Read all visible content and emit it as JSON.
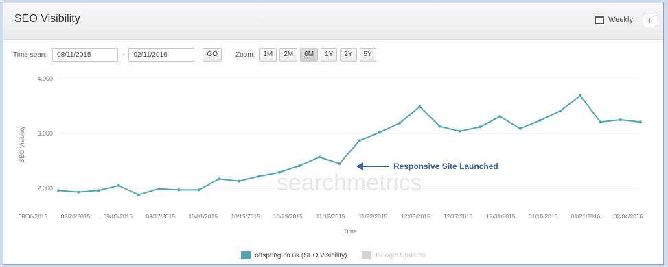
{
  "widget": {
    "title": "SEO Visibility",
    "weekly_label": "Weekly",
    "add_label": "+"
  },
  "controls": {
    "time_span_label": "Time span:",
    "date_from": "08/11/2015",
    "date_sep": "-",
    "date_to": "02/11/2016",
    "go_label": "GO",
    "zoom_label": "Zoom:",
    "zoom_options": [
      "1M",
      "2M",
      "6M",
      "1Y",
      "2Y",
      "5Y"
    ],
    "zoom_active": "6M"
  },
  "chart_data": {
    "type": "line",
    "ylabel": "SEO Visibility",
    "xlabel": "Time",
    "ylim": [
      1800,
      4000
    ],
    "y_ticks": [
      "4,000",
      "3,000",
      "2,000"
    ],
    "x_tick_labels": [
      "08/06/2015",
      "08/20/2015",
      "09/03/2015",
      "09/17/2015",
      "10/01/2015",
      "10/15/2015",
      "10/29/2015",
      "11/12/2015",
      "11/22/2015",
      "12/03/2015",
      "12/17/2015",
      "12/31/2015",
      "01/10/2016",
      "01/21/2016",
      "02/04/2016"
    ],
    "series": [
      {
        "name": "offspring.co.uk (SEO Visibility)",
        "color": "#4ca6b5",
        "values": [
          1960,
          1930,
          1960,
          2050,
          1880,
          1990,
          1970,
          1970,
          2170,
          2130,
          2220,
          2290,
          2410,
          2570,
          2450,
          2870,
          3020,
          3190,
          3490,
          3130,
          3040,
          3120,
          3310,
          3090,
          3240,
          3410,
          3690,
          3210,
          3250,
          3210
        ]
      }
    ],
    "legend": [
      {
        "label": "offspring.co.uk (SEO Visibility)",
        "color": "#4ca6b5"
      },
      {
        "label": "Google Updates",
        "color": "#d3d3d3"
      }
    ],
    "annotation": "Responsive Site Launched",
    "watermark": "searchmetrics"
  }
}
